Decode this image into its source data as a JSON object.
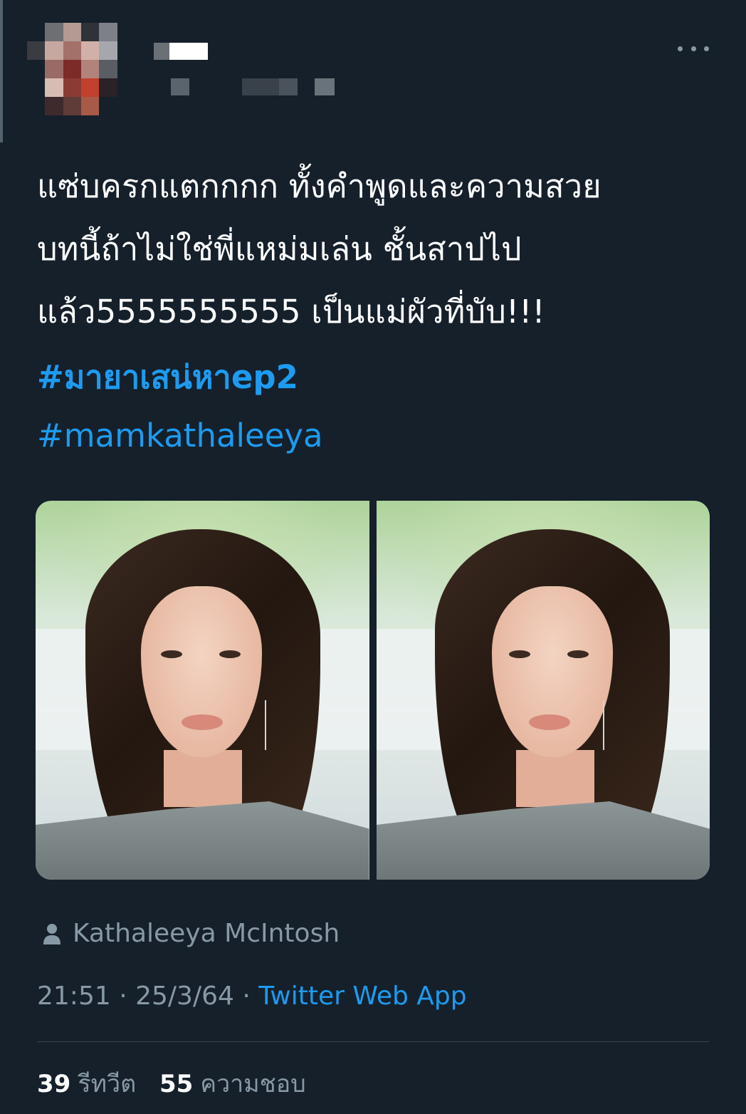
{
  "tweet": {
    "text_lines": [
      "แซ่บครกแตกกกก ทั้งคำพูดและความสวย",
      "บทนี้ถ้าไม่ใช่พี่แหม่มเล่น ชั้นสาปไป",
      "แล้ว5555555555 เป็นแม่ผัวที่บับ!!!"
    ],
    "hashtags": [
      "#มายาเสน่หาep2",
      "#mamkathaleeya"
    ],
    "tagged_person": "Kathaleeya McIntosh",
    "time": "21:51",
    "date": "25/3/64",
    "separator": "·",
    "source": "Twitter Web App",
    "retweets_count": "39",
    "retweets_label": "รีทวีต",
    "likes_count": "55",
    "likes_label": "ความชอบ"
  },
  "icons": {
    "more": "more-horizontal-icon",
    "person": "person-icon"
  },
  "colors": {
    "background": "#15202b",
    "link": "#1d9bf0",
    "secondary_text": "#8899a6",
    "divider": "#38444d"
  }
}
